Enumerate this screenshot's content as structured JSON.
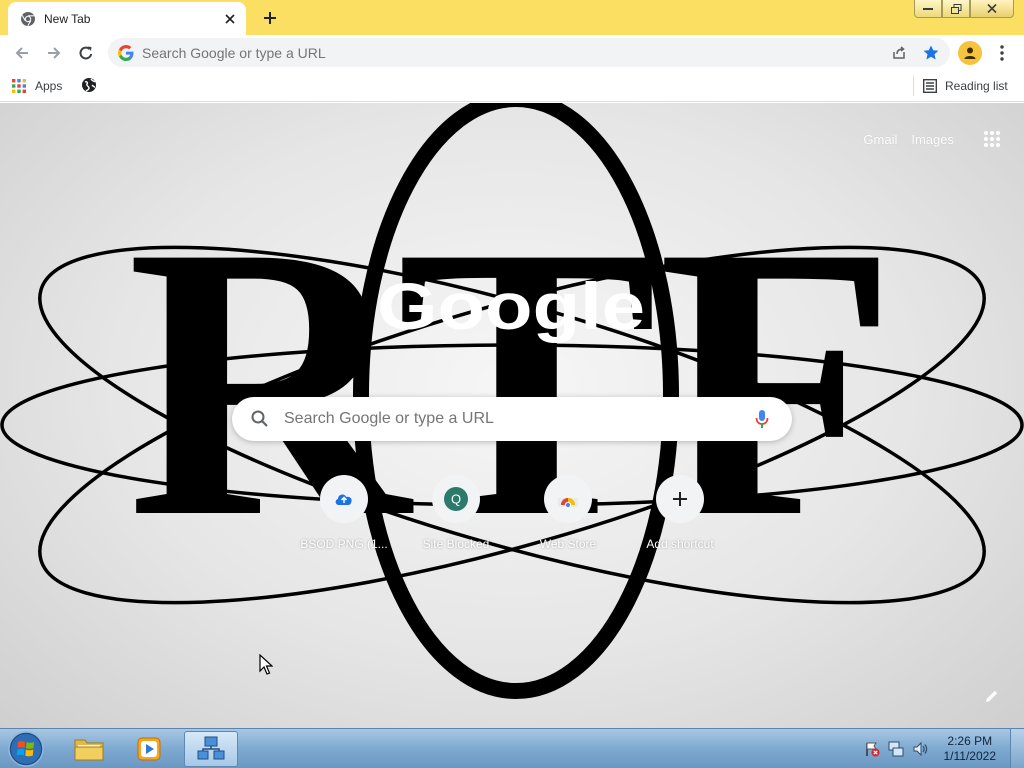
{
  "tab": {
    "title": "New Tab",
    "favicon": "chrome-icon"
  },
  "window": {
    "frame_color": "#fadf63"
  },
  "toolbar": {
    "omnibox_placeholder": "Search Google or type a URL",
    "back_icon": "arrow-left-icon",
    "forward_icon": "arrow-right-icon",
    "reload_icon": "reload-icon",
    "star_color": "#1a73e8"
  },
  "bookmarks": {
    "apps_label": "Apps",
    "reading_list_label": "Reading list"
  },
  "ntp": {
    "gmail_label": "Gmail",
    "images_label": "Images",
    "logo_text": "Google",
    "search_placeholder": "Search Google or type a URL",
    "shortcuts": [
      {
        "label": "BSOD PNG (1...",
        "icon": "cloud-upload-icon"
      },
      {
        "label": "Site Blocked",
        "icon": "letter-q-icon",
        "letter": "Q"
      },
      {
        "label": "Web Store",
        "icon": "web-store-icon"
      },
      {
        "label": "Add shortcut",
        "icon": "plus-icon"
      }
    ],
    "background_text": "RTF"
  },
  "taskbar": {
    "items": [
      {
        "name": "file-explorer",
        "icon": "folder-icon"
      },
      {
        "name": "media-player",
        "icon": "media-player-icon"
      },
      {
        "name": "network-app",
        "icon": "network-icon",
        "active": true
      }
    ],
    "clock": {
      "time": "2:26 PM",
      "date": "1/11/2022"
    }
  }
}
